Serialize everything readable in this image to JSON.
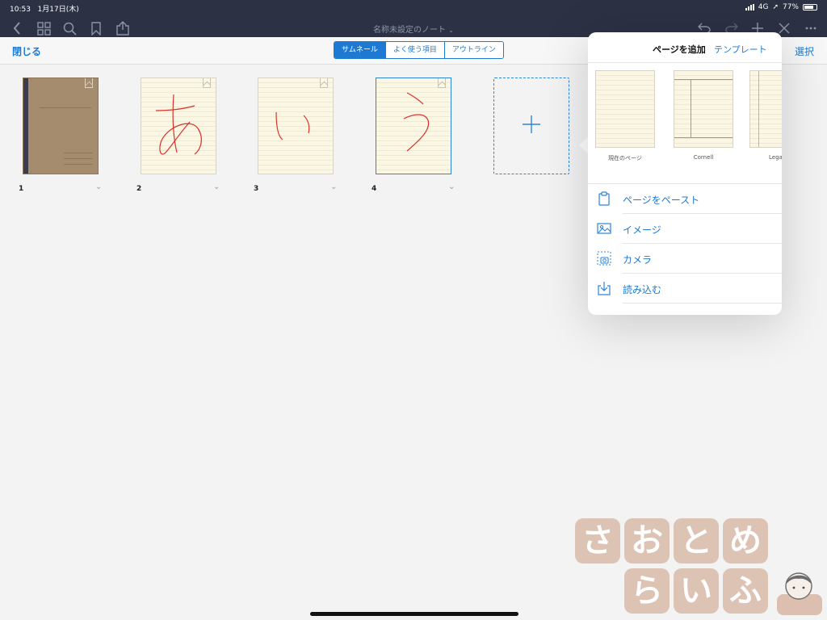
{
  "status": {
    "time": "10:53",
    "date": "1月17日(木)",
    "network": "4G",
    "battery": "77%",
    "battery_level": 0.77
  },
  "toolbar": {
    "document_title": "名称未設定のノート",
    "icons": [
      "back-icon",
      "grid-icon",
      "search-icon",
      "bookmark-icon",
      "share-icon",
      "undo-icon",
      "redo-icon",
      "plus-icon",
      "close-tools-icon",
      "more-icon"
    ]
  },
  "subbar": {
    "close_label": "閉じる",
    "select_label": "選択",
    "segments": [
      "サムネール",
      "よく使う項目",
      "アウトライン"
    ]
  },
  "pages": [
    {
      "number": "1",
      "kind": "cover"
    },
    {
      "number": "2",
      "kind": "handwriting",
      "glyph": "あ"
    },
    {
      "number": "3",
      "kind": "handwriting",
      "glyph": "い"
    },
    {
      "number": "4",
      "kind": "handwriting",
      "glyph": "う",
      "selected": true
    }
  ],
  "popover": {
    "title": "ページを追加",
    "template_link": "テンプレート",
    "templates": [
      "現在のページ",
      "Cornell",
      "Lega"
    ],
    "actions": [
      {
        "label": "ページをペースト",
        "icon": "clipboard-icon"
      },
      {
        "label": "イメージ",
        "icon": "image-icon"
      },
      {
        "label": "カメラ",
        "icon": "camera-icon"
      },
      {
        "label": "読み込む",
        "icon": "import-icon"
      }
    ]
  },
  "watermark": {
    "row1": [
      "さ",
      "お",
      "と",
      "め"
    ],
    "row2": [
      "ら",
      "い",
      "ふ"
    ]
  },
  "colors": {
    "accent": "#1d79d1",
    "toolbar_bg": "#2c3144",
    "handwriting": "#d8322f"
  }
}
